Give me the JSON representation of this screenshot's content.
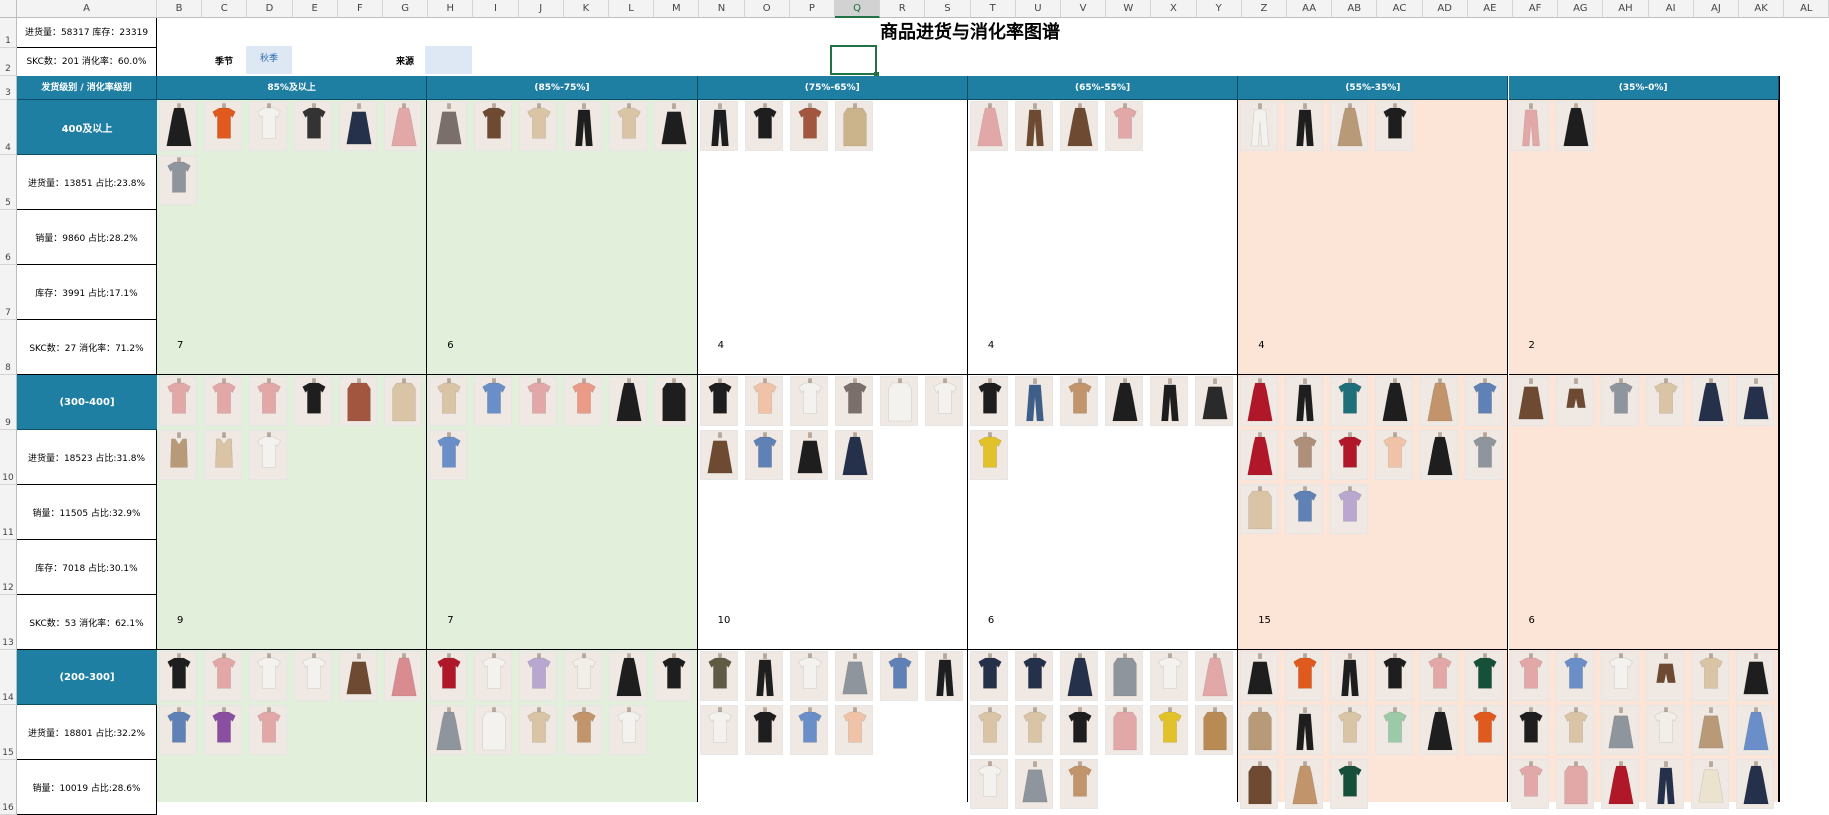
{
  "columns": [
    "A",
    "B",
    "C",
    "D",
    "E",
    "F",
    "G",
    "H",
    "I",
    "J",
    "K",
    "L",
    "M",
    "N",
    "O",
    "P",
    "Q",
    "R",
    "S",
    "T",
    "U",
    "V",
    "W",
    "X",
    "Y",
    "Z",
    "AA",
    "AB",
    "AC",
    "AD",
    "AE",
    "AF",
    "AG",
    "AH",
    "AI",
    "AJ",
    "AK",
    "AL"
  ],
  "rows": [
    "1",
    "2",
    "3",
    "4",
    "5",
    "6",
    "7",
    "8",
    "9",
    "10",
    "11",
    "12",
    "13",
    "14",
    "15",
    "16"
  ],
  "title": "商品进货与消化率图谱",
  "summary": {
    "line1": "进货量：58317    库存：23319",
    "line2": "SKC数：201    消化率：60.0%"
  },
  "filters": {
    "season_label": "季节",
    "season_value": "秋季",
    "source_label": "来源",
    "source_value": ""
  },
  "header": {
    "corner": "发货级别 / 消化率级别",
    "buckets": [
      "85%及以上",
      "(85%-75%]",
      "(75%-65%]",
      "(65%-55%]",
      "(55%-35%]",
      "(35%-0%]"
    ]
  },
  "groups": [
    {
      "level": "400及以上",
      "stats": [
        "进货量：13851    占比:23.8%",
        "销量：9860    占比:28.2%",
        "库存：3991    占比:17.1%",
        "SKC数：27    消化率：71.2%"
      ],
      "counts": [
        "7",
        "6",
        "4",
        "4",
        "4",
        "2"
      ],
      "items": [
        [
          "black-dress-icon",
          "orange-top-icon",
          "white-cardigan-icon",
          "argyle-sweater-icon",
          "navy-skirt-icon",
          "pink-dress-icon",
          "gray-sweater-icon"
        ],
        [
          "plaid-skirt-icon",
          "brown-cardigan-icon",
          "beige-jacket-icon",
          "black-pants-icon",
          "beige-cardigan-icon",
          "black-skirt-icon"
        ],
        [
          "black-pants-icon",
          "black-top-icon",
          "rust-jacket-icon",
          "trench-coat-icon"
        ],
        [
          "pink-dress-icon",
          "brown-pants-icon",
          "brown-dress-icon",
          "pink-top-icon"
        ],
        [
          "white-pants-icon",
          "black-pants-icon",
          "tan-dress-icon",
          "black-top-icon"
        ],
        [
          "pink-pants-icon",
          "black-dress-icon"
        ]
      ]
    },
    {
      "level": "(300-400]",
      "stats": [
        "进货量：18523    占比:31.8%",
        "销量：11505    占比:32.9%",
        "库存：7018    占比:30.1%",
        "SKC数：53    消化率：62.1%"
      ],
      "counts": [
        "9",
        "7",
        "10",
        "6",
        "15",
        "6"
      ],
      "items": [
        [
          "pink-sweater-icon",
          "pink-jacket-icon",
          "pink-hoodie-icon",
          "black-tee-icon",
          "rust-coat-icon",
          "beige-trench-icon",
          "tan-vest-icon",
          "beige-vest-icon",
          "white-tee-icon"
        ],
        [
          "beige-top-icon",
          "blue-sweater-icon",
          "pink-top-icon",
          "salmon-sweater-icon",
          "black-dress-icon",
          "black-coat-icon",
          "blue-top-icon"
        ],
        [
          "black-cardigan-icon",
          "peach-sweater-icon",
          "white-sweater-icon",
          "plaid-jacket-icon",
          "white-coat-icon",
          "white-blouse-icon",
          "brown-skirt-icon",
          "jeans-icon",
          "black-skirt-icon",
          "navy-dress-icon"
        ],
        [
          "black-jacket-icon",
          "flare-jeans-icon",
          "print-blouse-icon",
          "black-dress-icon",
          "black-pants-icon",
          "tulle-skirt-icon",
          "yellow-sweater-icon"
        ],
        [
          "red-dress-icon",
          "black-pants-icon",
          "teal-sweater-icon",
          "black-dress-icon",
          "print-dress-icon",
          "jeans-icon",
          "red-dress-icon",
          "stripe-sweater-icon",
          "red-top-icon",
          "peach-top-icon",
          "black-dress-icon",
          "gray-top-icon",
          "beige-coat-icon",
          "jeans-icon",
          "lilac-top-icon"
        ],
        [
          "brown-skirt-icon",
          "brown-shorts-icon",
          "gray-sweater-icon",
          "beige-sweater-icon",
          "navy-dress-icon",
          "navy-skirt-icon"
        ]
      ]
    },
    {
      "level": "(200-300]",
      "stats": [
        "进货量：18801    占比:32.2%",
        "销量：10019    占比:28.6%"
      ],
      "counts": [],
      "items": [
        [
          "black-cardigan-icon",
          "pink-sweater-icon",
          "white-top-icon",
          "white-shirt-icon",
          "brown-skirt-icon",
          "rose-dress-icon",
          "jeans-icon",
          "purple-sweater-icon",
          "pink-jacket-icon"
        ],
        [
          "red-sweater-icon",
          "white-shirt-icon",
          "lilac-top-icon",
          "bow-blouse-icon",
          "black-dress-icon",
          "black-jacket-icon",
          "gray-dress-icon",
          "white-coat-icon",
          "beige-top-icon",
          "print-cardigan-icon",
          "white-blouse-icon"
        ],
        [
          "olive-jacket-icon",
          "black-pants-icon",
          "white-top-icon",
          "gray-skirt-icon",
          "jeans-icon",
          "black-pants-icon",
          "white-tee-icon",
          "black-cardigan-icon",
          "blue-shirt-icon",
          "peach-top-icon"
        ],
        [
          "navy-sweater-icon",
          "navy-top-icon",
          "navy-dress-icon",
          "gray-coat-icon",
          "white-sweater-icon",
          "pink-dress-icon",
          "beige-jacket-icon",
          "beige-jacket-icon",
          "black-top-icon",
          "pink-coat-icon",
          "yellow-sweater-icon",
          "camel-coat-icon",
          "white-tee-icon",
          "gray-skirt-icon",
          "print-tee-icon"
        ],
        [
          "black-skirt-icon",
          "orange-top-icon",
          "black-pants-icon",
          "black-jacket-icon",
          "pink-top-icon",
          "green-sweater-icon",
          "tan-coat-icon",
          "black-pants-icon",
          "beige-cardigan-icon",
          "mint-top-icon",
          "black-dress-icon",
          "orange-sweater-icon",
          "brown-coat-icon",
          "print-dress-icon",
          "green-sweater-icon"
        ],
        [
          "pink-sweater-icon",
          "blue-blouse-icon",
          "white-blouse-icon",
          "brown-shorts-icon",
          "beige-top-icon",
          "black-skirt-icon",
          "black-sweater-icon",
          "beige-cardigan-icon",
          "gray-skirt-icon",
          "bow-blouse-icon",
          "tan-skirt-icon",
          "blue-dress-icon",
          "pink-top-icon",
          "pink-coat-icon",
          "red-dress-icon",
          "navy-pants-icon",
          "cream-skirt-icon",
          "navy-dress-icon"
        ]
      ]
    }
  ]
}
